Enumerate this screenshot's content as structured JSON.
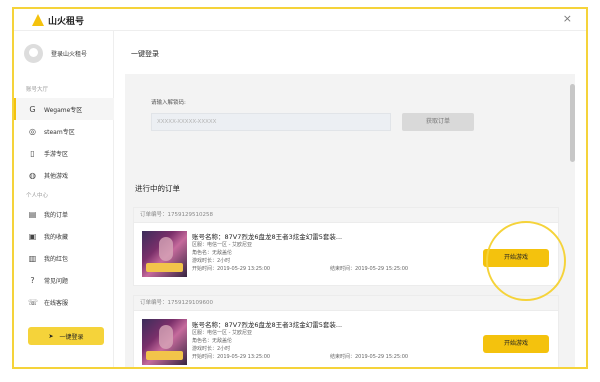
{
  "app": {
    "name": "山火租号",
    "close": "×"
  },
  "sidebar": {
    "login": "登录山火租号",
    "section1": "账号大厅",
    "items": [
      {
        "label": "Wegame专区",
        "icon": "wegame-icon",
        "active": true
      },
      {
        "label": "steam专区",
        "icon": "steam-icon"
      },
      {
        "label": "手游专区",
        "icon": "phone-icon"
      },
      {
        "label": "其他游戏",
        "icon": "gamepad-icon"
      }
    ],
    "section2": "个人中心",
    "personal": [
      {
        "label": "我的订单",
        "icon": "order-icon"
      },
      {
        "label": "我的收藏",
        "icon": "favorite-icon"
      },
      {
        "label": "我的红包",
        "icon": "redpacket-icon"
      },
      {
        "label": "常见问题",
        "icon": "question-icon"
      },
      {
        "label": "在线客服",
        "icon": "service-icon"
      }
    ],
    "quick_login": "一键登录"
  },
  "main": {
    "title": "一键登录",
    "code_label": "请输入解锁码:",
    "code_value": "XXXXX-XXXXX-XXXXX",
    "code_button": "获取订单",
    "orders_title": "进行中的订单",
    "orders": [
      {
        "order_no": "订单编号：1759129510258",
        "name": "账号名称：87V7烈龙6盘龙8王者3炫金幻雷5套装...",
        "region": "区服：电信一区 - 艾欧尼亚",
        "role": "角色名：无敌盖伦",
        "duration": "游戏时长：2小时",
        "start": "开始时间：2019-05-29 13:25:00",
        "end": "结束时间：2019-05-29 15:25:00",
        "button": "开始游戏"
      },
      {
        "order_no": "订单编号：1759129109600",
        "name": "账号名称：87V7烈龙6盘龙8王者3炫金幻雷5套装...",
        "region": "区服：电信一区 - 艾欧尼亚",
        "role": "角色名：无敌盖伦",
        "duration": "游戏时长：2小时",
        "start": "开始时间：2019-05-29 13:25:00",
        "end": "结束时间：2019-05-29 15:25:00",
        "button": "开始游戏"
      }
    ]
  },
  "colors": {
    "accent": "#f4c20d",
    "border": "#f5d33a"
  }
}
